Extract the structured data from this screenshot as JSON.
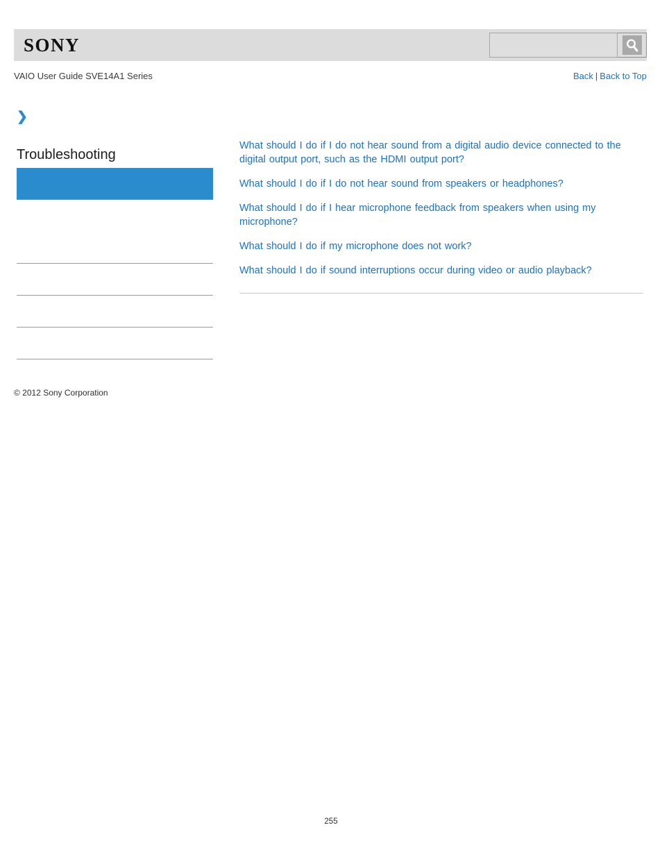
{
  "header": {
    "logo_text": "SONY",
    "search": {
      "value": "",
      "placeholder": "",
      "icon": "search-icon",
      "button_label": ""
    }
  },
  "sub_header": {
    "guide_title": "VAIO User Guide SVE14A1 Series",
    "nav": {
      "back_label": "Back",
      "separator": "|",
      "back_to_top_label": "Back to Top"
    }
  },
  "sidebar": {
    "breadcrumb_arrow_icon": "chevron-right-icon",
    "breadcrumb_arrow_glyph": "❯",
    "heading": "Troubleshooting",
    "items": [
      {
        "label": "",
        "active": true
      },
      {
        "label": "",
        "active": false
      },
      {
        "label": "",
        "active": false
      },
      {
        "label": "",
        "active": false
      },
      {
        "label": "",
        "active": false
      },
      {
        "label": "",
        "active": false
      }
    ]
  },
  "main": {
    "topics": [
      "What should I do if I do not hear sound from a digital audio device connected to the digital output port, such as the HDMI output port?",
      "What should I do if I do not hear sound from speakers or headphones?",
      "What should I do if I hear microphone feedback from speakers when using my microphone?",
      "What should I do if my microphone does not work?",
      "What should I do if sound interruptions occur during video or audio playback?"
    ]
  },
  "footer": {
    "copyright": "© 2012 Sony Corporation",
    "page_number": "255"
  },
  "colors": {
    "accent_blue": "#2a8ccd",
    "link_blue": "#1a72c4",
    "header_gray": "#dcdcdc",
    "rule_gray": "#c9c9c9"
  }
}
